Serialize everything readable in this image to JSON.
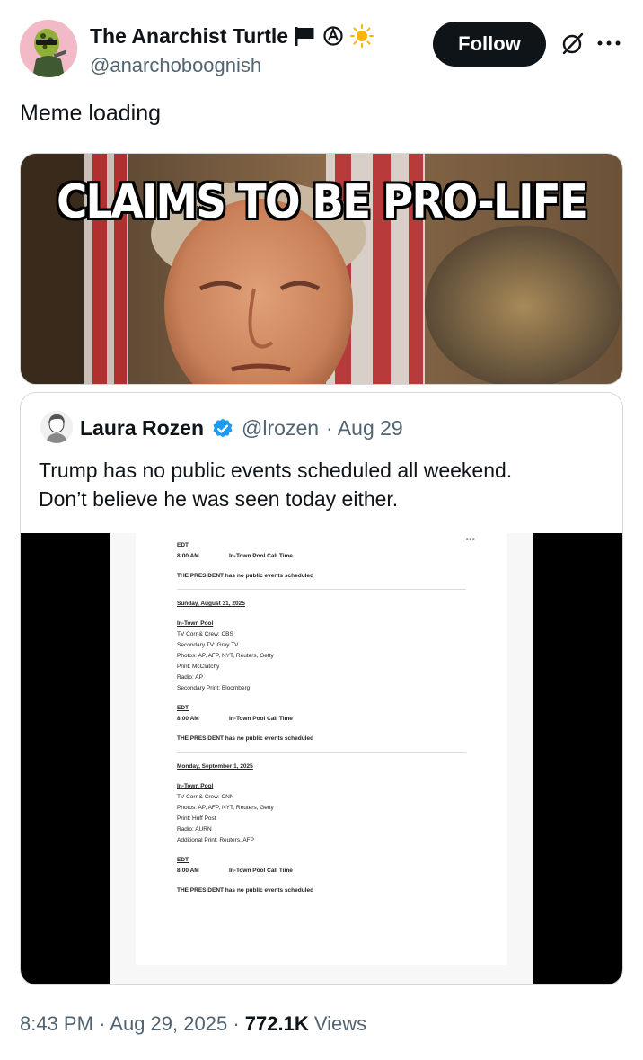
{
  "author": {
    "display_name": "The Anarchist Turtle",
    "handle": "@anarchoboognish",
    "badges": [
      "black-flag-icon",
      "anarchy-circle-icon",
      "sun-icon"
    ]
  },
  "actions": {
    "follow_label": "Follow",
    "grok_icon": "grok-icon",
    "more_icon": "more-icon"
  },
  "tweet": {
    "text": "Meme loading",
    "meme_caption": "CLAIMS TO BE PRO-LIFE"
  },
  "quote": {
    "display_name": "Laura Rozen",
    "verified": true,
    "handle": "@lrozen",
    "date": "· Aug 29",
    "text_line1": "Trump has no public events scheduled all weekend.",
    "text_line2": "Don’t believe he was seen today either.",
    "document": {
      "block1": {
        "edt": "EDT",
        "time": "8:00 AM",
        "event": "In-Town Pool Call Time",
        "status": "THE PRESIDENT has no public events scheduled"
      },
      "block2": {
        "date": "Sunday, August 31, 2025",
        "pool": "In-Town Pool",
        "lines": [
          "TV Corr & Crew: CBS",
          "Secondary TV: Gray TV",
          "Photos: AP, AFP, NYT, Reuters, Getty",
          "Print: McClatchy",
          "Radio: AP",
          "Secondary Print: Bloomberg"
        ],
        "edt": "EDT",
        "time": "8:00 AM",
        "event": "In-Town Pool Call Time",
        "status": "THE PRESIDENT has no public events scheduled"
      },
      "block3": {
        "date": "Monday, September 1, 2025",
        "pool": "In-Town Pool",
        "lines": [
          "TV Corr & Crew: CNN",
          "Photos: AP, AFP, NYT, Reuters, Getty",
          "Print: Huff Post",
          "Radio: AURN",
          "Additional Print: Reuters, AFP"
        ],
        "edt": "EDT",
        "time": "8:00 AM",
        "event": "In-Town Pool Call Time",
        "status": "THE PRESIDENT has no public events scheduled"
      }
    }
  },
  "meta": {
    "time": "8:43 PM",
    "date": "Aug 29, 2025",
    "views_count": "772.1K",
    "views_label": "Views"
  },
  "colors": {
    "text_primary": "#0f1419",
    "text_secondary": "#536471",
    "verified_blue": "#1d9bf0",
    "follow_bg": "#0f1419",
    "border": "#cfd9de"
  }
}
